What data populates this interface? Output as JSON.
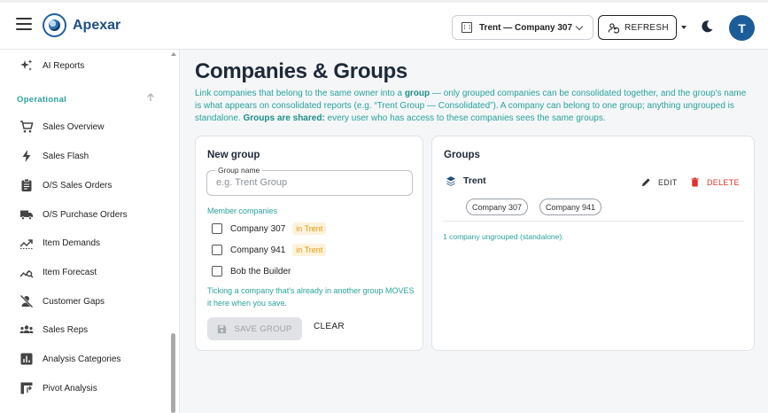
{
  "app": {
    "brand": "Apexar",
    "avatar_initial": "T"
  },
  "header": {
    "company_selector": "Trent — Company 307",
    "refresh_label": "REFRESH"
  },
  "sidebar": {
    "top_item": "AI Reports",
    "section_label": "Operational",
    "items": [
      {
        "label": "Sales Overview",
        "icon": "cart-icon"
      },
      {
        "label": "Sales Flash",
        "icon": "bolt-icon"
      },
      {
        "label": "O/S Sales Orders",
        "icon": "clipboard-icon"
      },
      {
        "label": "O/S Purchase Orders",
        "icon": "truck-icon"
      },
      {
        "label": "Item Demands",
        "icon": "trend-icon"
      },
      {
        "label": "Item Forecast",
        "icon": "forecast-icon"
      },
      {
        "label": "Customer Gaps",
        "icon": "person-off-icon"
      },
      {
        "label": "Sales Reps",
        "icon": "groups-icon"
      },
      {
        "label": "Analysis Categories",
        "icon": "analytics-icon"
      },
      {
        "label": "Pivot Analysis",
        "icon": "pivot-icon"
      }
    ]
  },
  "page": {
    "title": "Companies & Groups",
    "desc_1": "Link companies that belong to the same owner into a ",
    "desc_group": "group",
    "desc_2": " — only grouped companies can be consolidated together, and the group's name is what appears on consolidated reports (e.g. “Trent Group — Consolidated”). A company can belong to one group; anything ungrouped is standalone. ",
    "desc_shared": "Groups are shared:",
    "desc_3": " every user who has access to these companies sees the same groups."
  },
  "new_group": {
    "title": "New group",
    "field_label": "Group name",
    "field_placeholder": "e.g. Trent Group",
    "members_label": "Member companies",
    "members": [
      {
        "name": "Company 307",
        "tag": "in Trent"
      },
      {
        "name": "Company 941",
        "tag": "in Trent"
      },
      {
        "name": "Bob the Builder",
        "tag": ""
      }
    ],
    "note": "Ticking a company that's already in another group MOVES it here when you save.",
    "save_label": "SAVE GROUP",
    "clear_label": "CLEAR"
  },
  "groups": {
    "title": "Groups",
    "group_name": "Trent",
    "edit_label": "EDIT",
    "delete_label": "DELETE",
    "chips": [
      "Company 307",
      "Company 941"
    ],
    "ungrouped_note": "1 company ungrouped (standalone)."
  },
  "colors": {
    "accent": "#2aa39a",
    "brand": "#1c5d99",
    "danger": "#e0312d",
    "tag": "#e19a12"
  }
}
